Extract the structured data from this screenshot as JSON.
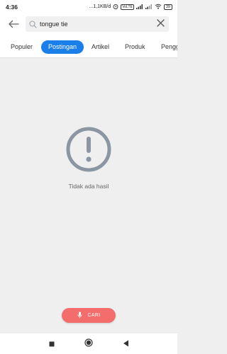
{
  "status_bar": {
    "time": "4:36",
    "speed": "...1,1KB/d",
    "battery": "39",
    "volte_label": "VoLTE",
    "network_label": "4G"
  },
  "search": {
    "value": "tongue tie",
    "placeholder": ""
  },
  "tabs": [
    {
      "label": "Populer"
    },
    {
      "label": "Postingan",
      "active": true
    },
    {
      "label": "Artikel"
    },
    {
      "label": "Produk"
    },
    {
      "label": "Pengguna"
    }
  ],
  "empty_state": {
    "message": "Tidak ada hasil",
    "icon": "exclamation-circle-icon"
  },
  "cari_button": {
    "label": "CARI",
    "icon": "microphone-icon"
  },
  "nav": {
    "recents_icon": "square-icon",
    "home_icon": "circle-icon",
    "back_icon": "triangle-back-icon"
  },
  "colors": {
    "accent": "#1a7fe8",
    "cari": "#f36d6d",
    "empty_icon": "#8a96a1"
  }
}
